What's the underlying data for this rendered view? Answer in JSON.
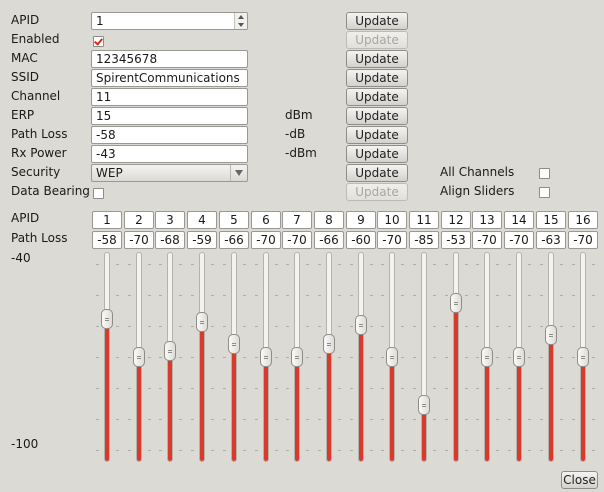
{
  "settings": {
    "apid": {
      "label": "APID",
      "value": "1",
      "update": "Update",
      "update_enabled": true
    },
    "enabled": {
      "label": "Enabled",
      "checked": true,
      "update": "Update",
      "update_enabled": false
    },
    "mac": {
      "label": "MAC",
      "value": "12345678",
      "update": "Update",
      "update_enabled": true
    },
    "ssid": {
      "label": "SSID",
      "value": "SpirentCommunications",
      "update": "Update",
      "update_enabled": true
    },
    "channel": {
      "label": "Channel",
      "value": "11",
      "update": "Update",
      "update_enabled": true
    },
    "erp": {
      "label": "ERP",
      "value": "15",
      "unit": "dBm",
      "update": "Update",
      "update_enabled": true
    },
    "path_loss": {
      "label": "Path Loss",
      "value": "-58",
      "unit": "-dB",
      "update": "Update",
      "update_enabled": true
    },
    "rx_power": {
      "label": "Rx Power",
      "value": "-43",
      "unit": "-dBm",
      "update": "Update",
      "update_enabled": true
    },
    "security": {
      "label": "Security",
      "value": "WEP",
      "update": "Update",
      "update_enabled": true
    },
    "data_bearing": {
      "label": "Data Bearing",
      "checked": false,
      "update": "Update",
      "update_enabled": false
    }
  },
  "options": {
    "all_channels": {
      "label": "All Channels",
      "checked": false
    },
    "align_sliders": {
      "label": "Align Sliders",
      "checked": false
    }
  },
  "channels": {
    "apid_label": "APID",
    "path_loss_label": "Path Loss",
    "scale_top": "-40",
    "scale_bottom": "-100",
    "scale_min": -100,
    "scale_max": -40,
    "apids": [
      "1",
      "2",
      "3",
      "4",
      "5",
      "6",
      "7",
      "8",
      "9",
      "10",
      "11",
      "12",
      "13",
      "14",
      "15",
      "16"
    ],
    "path_loss_text": [
      "-58",
      "-70",
      "-68",
      "-59",
      "-66",
      "-70",
      "-70",
      "-66",
      "-60",
      "-70",
      "-85",
      "-53",
      "-70",
      "-70",
      "-63",
      "-70"
    ],
    "path_loss": [
      -58,
      -70,
      -68,
      -59,
      -66,
      -70,
      -70,
      -66,
      -60,
      -70,
      -85,
      -53,
      -70,
      -70,
      -63,
      -70
    ]
  },
  "footer": {
    "close": "Close"
  },
  "colors": {
    "accent": "#d93a2b",
    "background": "#dcdad5"
  }
}
